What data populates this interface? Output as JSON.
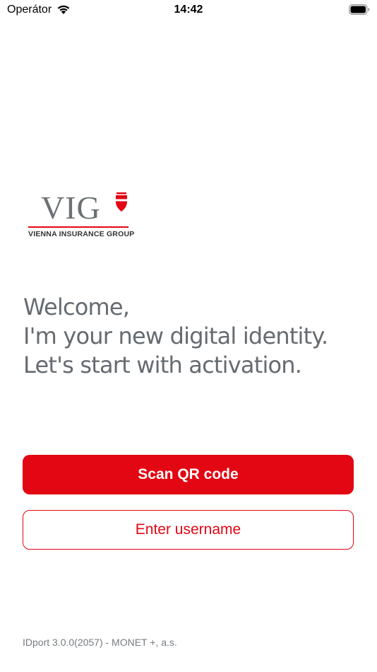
{
  "status_bar": {
    "carrier": "Operátor",
    "time": "14:42",
    "wifi_icon": "wifi-icon",
    "battery_icon": "battery-icon"
  },
  "logo": {
    "wordmark": "VIG",
    "subtitle": "VIENNA INSURANCE GROUP",
    "brand_color": "#e30613",
    "wordmark_color": "#6b7073"
  },
  "welcome": {
    "line1": "Welcome,",
    "line2": "I'm your new digital identity.",
    "line3": "Let's start with activation."
  },
  "actions": {
    "scan_label": "Scan QR code",
    "username_label": "Enter username"
  },
  "footer": {
    "version": "IDport 3.0.0(2057) - MONET +, a.s."
  },
  "colors": {
    "accent": "#e30613",
    "text_muted": "#656b70"
  }
}
